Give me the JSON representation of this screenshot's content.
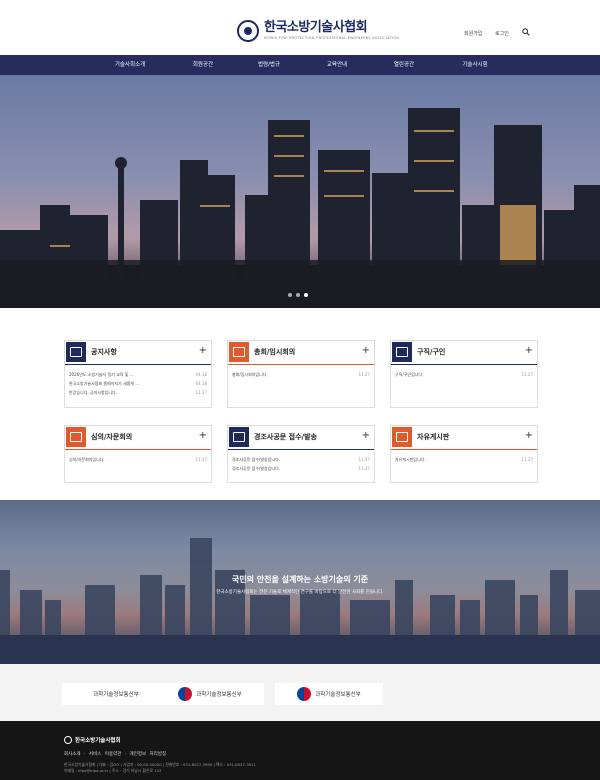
{
  "header": {
    "logo_name": "한국소방기술사협회",
    "logo_sub": "KOREA FIRE PROTECTION PROFESSIONAL ENGINEERS ASSOCIATION",
    "join": "회원가입",
    "login": "로그인",
    "search_icon": "search-icon"
  },
  "nav": [
    "기술사회소개",
    "회원공간",
    "법령/법규",
    "교육안내",
    "열린공간",
    "기술사시험"
  ],
  "hero": {
    "slides": 3,
    "active_slide": 3
  },
  "boards": [
    {
      "title": "공지사항",
      "accent": "#1e2a5e",
      "icon": "notice-icon",
      "rows": [
        [
          "2026년도 소방기술사 정기 교육 및 ...",
          "04.18"
        ],
        [
          "한국소방기술사협회 홈페이지가 새롭게 ...",
          "04.18"
        ],
        [
          "반갑습니다, 공지사항입니다.",
          "11.27"
        ]
      ]
    },
    {
      "title": "총회/임시회의",
      "accent": "#e05a2b",
      "icon": "gavel-icon",
      "rows": [
        [
          "총회/임시회의입니다.",
          "11.27"
        ]
      ]
    },
    {
      "title": "구직/구인",
      "accent": "#1e2a5e",
      "icon": "people-icon",
      "rows": [
        [
          "구직/구인입니다.",
          "11.27"
        ]
      ]
    },
    {
      "title": "심의/자문회의",
      "accent": "#e05a2b",
      "icon": "review-icon",
      "rows": [
        [
          "심의/자문회의입니다.",
          "11.27"
        ]
      ]
    },
    {
      "title": "경조사공문 접수/발송",
      "accent": "#1e2a5e",
      "icon": "group-icon",
      "rows": [
        [
          "경조사공문 접수/발송입니다.",
          "11.27"
        ],
        [
          "경조사공문 접수/발송입니다.",
          "11.27"
        ]
      ]
    },
    {
      "title": "자유게시판",
      "accent": "#e05a2b",
      "icon": "chat-icon",
      "rows": [
        [
          "자유게시판입니다.",
          "11.27"
        ]
      ]
    }
  ],
  "banner": {
    "title": "국민의 안전을 설계하는 소방기술의 기준",
    "subtitle": "한국소방기술사협회는 전문 기술로 체계적인 연구를 바탕으로 더 안전한 사회를 만듭니다."
  },
  "partners": [
    "과학기술정보통신부",
    "과학기술정보통신부",
    "과학기술정보통신부"
  ],
  "footer": {
    "logo_name": "한국소방기술사협회",
    "links": "회사소개 · 서비스 이용약관 · 개인정보 처리방침",
    "info_1": "한국소방기술사협회 | 대표 : 김OO | 사업자 : 00-00-00000 | 전화번호 : 031-8027-3900 | 팩스 : 031-8027-3911",
    "info_2": "이메일 : kfpa@kfpa.or.kr | 주소 : 경기 하남시 황산로 143"
  }
}
